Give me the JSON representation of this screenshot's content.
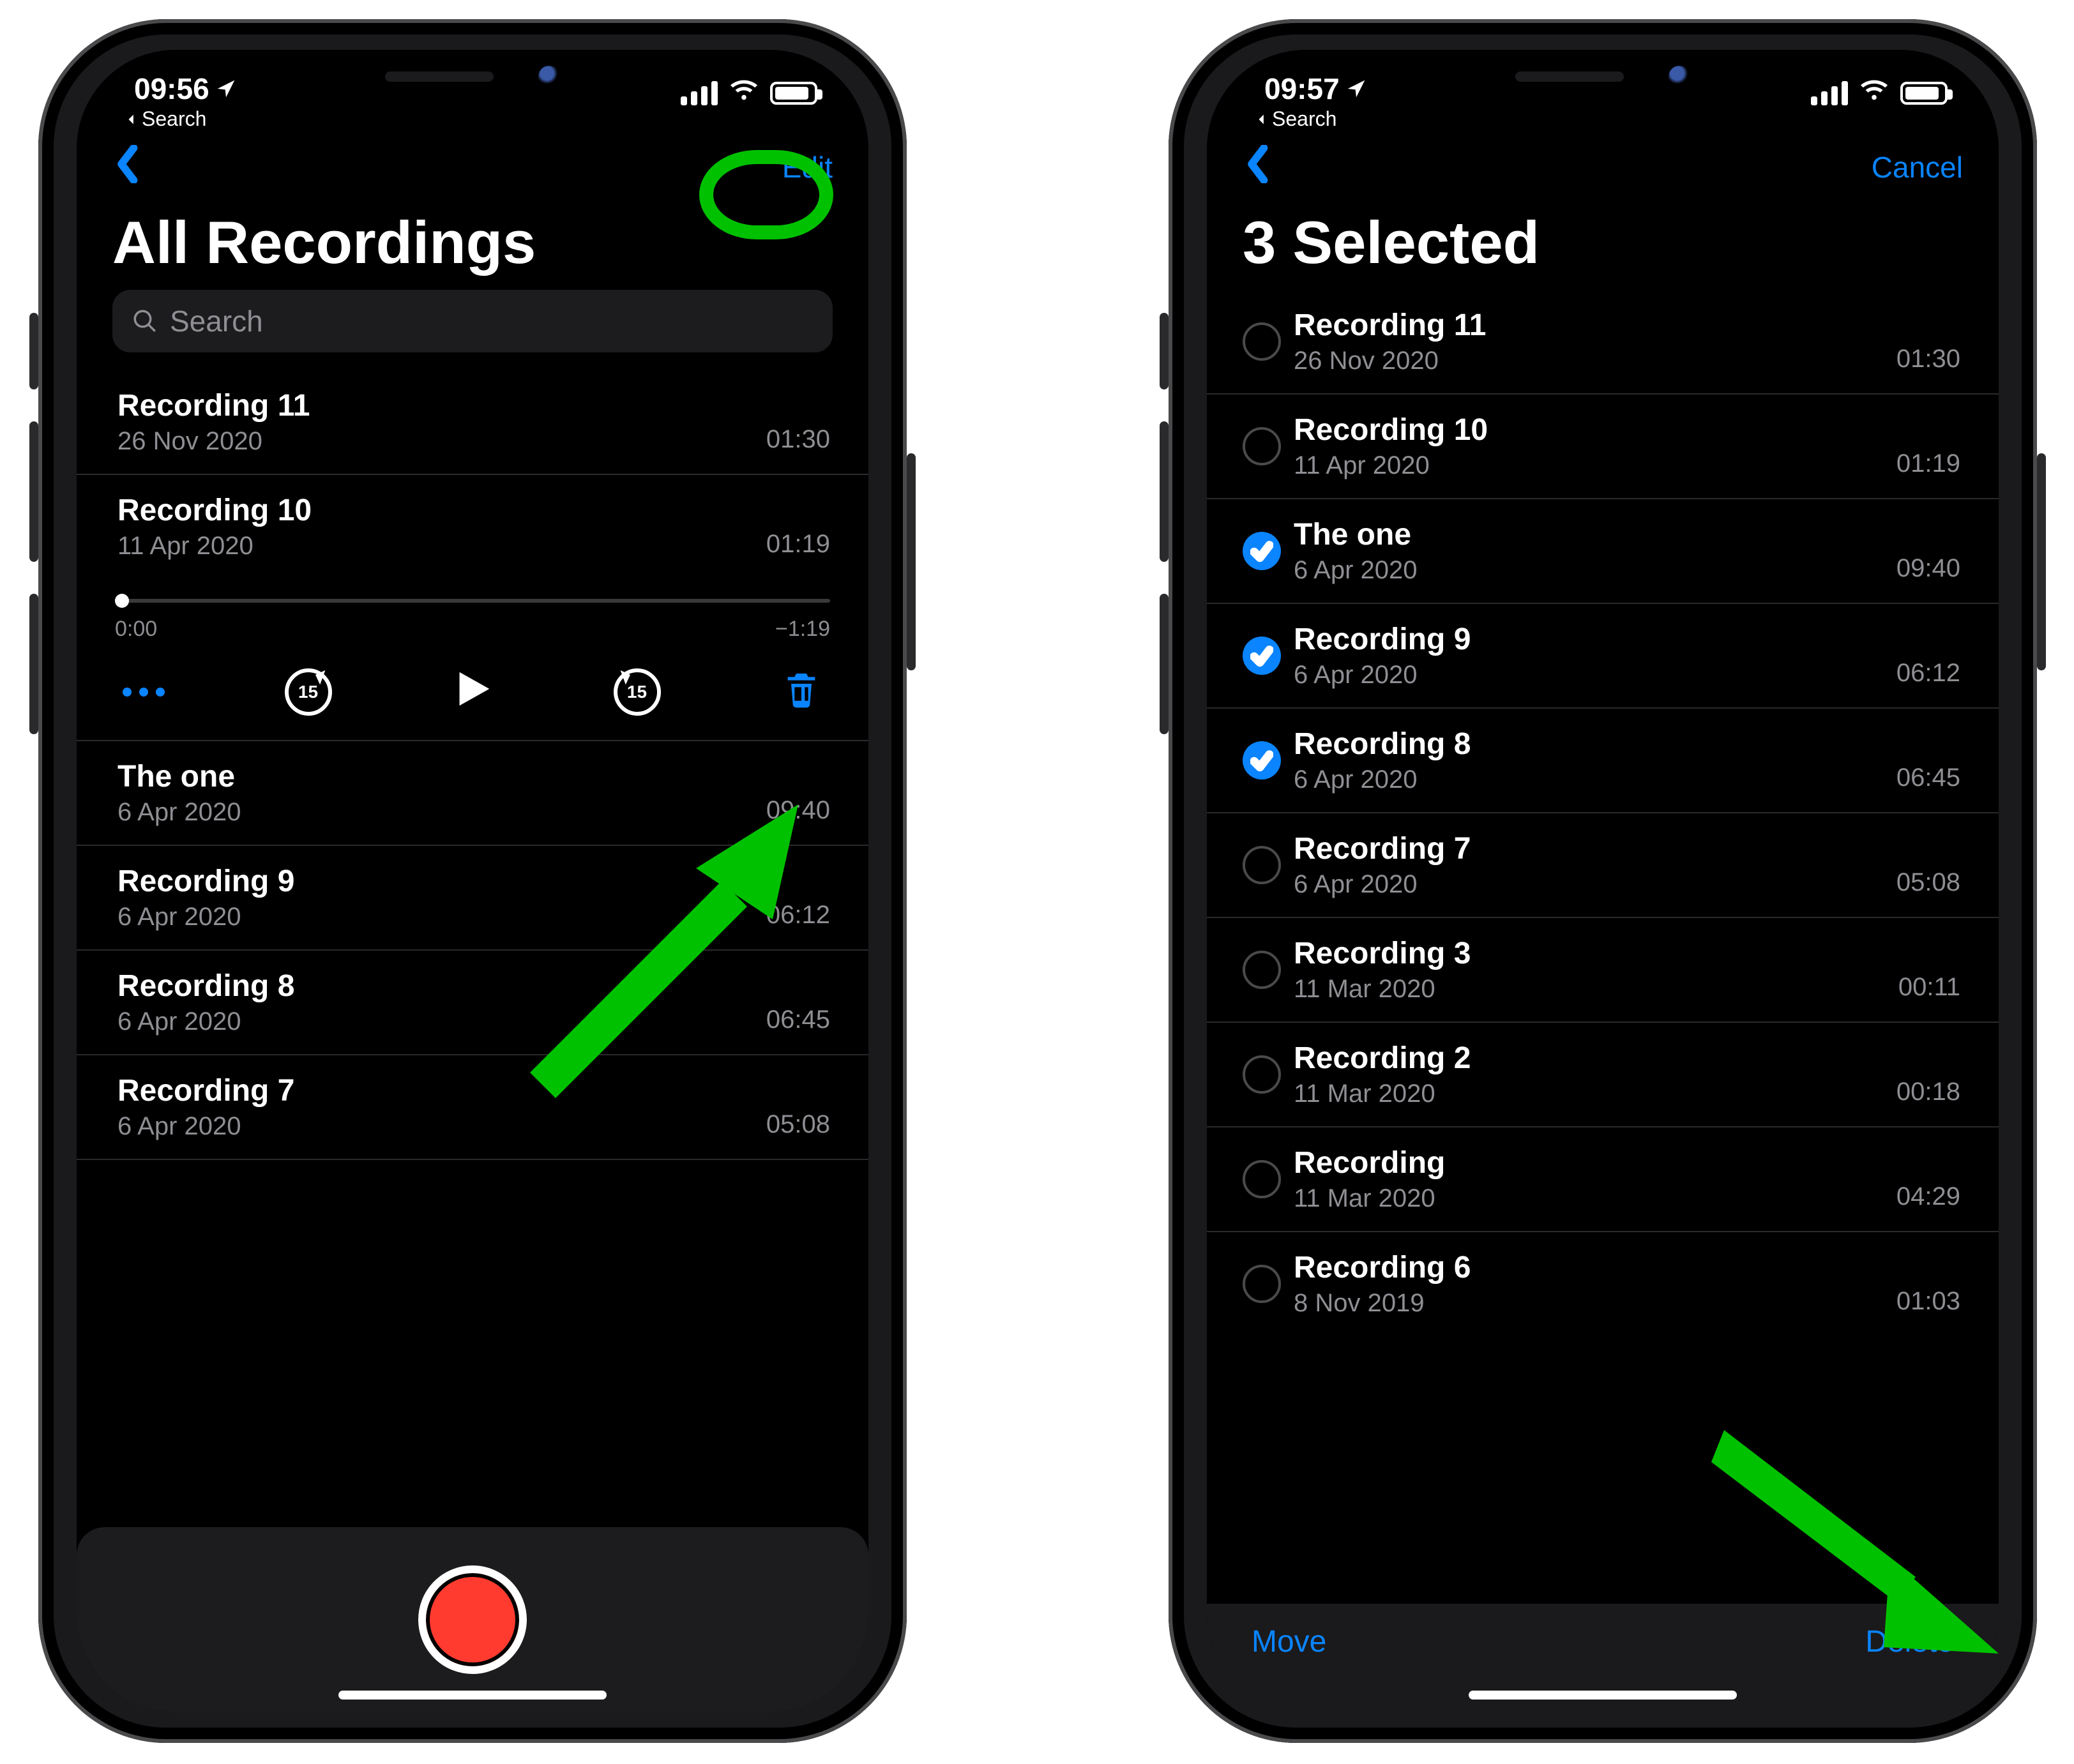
{
  "status": {
    "back_label": "Search"
  },
  "left": {
    "time": "09:56",
    "nav_edit": "Edit",
    "title": "All Recordings",
    "search_placeholder": "Search",
    "items": [
      {
        "name": "Recording 11",
        "date": "26 Nov 2020",
        "dur": "01:30"
      },
      {
        "name": "Recording 10",
        "date": "11 Apr 2020",
        "dur": "01:19"
      },
      {
        "name": "The one",
        "date": "6 Apr 2020",
        "dur": "09:40"
      },
      {
        "name": "Recording 9",
        "date": "6 Apr 2020",
        "dur": "06:12"
      },
      {
        "name": "Recording 8",
        "date": "6 Apr 2020",
        "dur": "06:45"
      },
      {
        "name": "Recording 7",
        "date": "6 Apr 2020",
        "dur": "05:08"
      }
    ],
    "player": {
      "pos": "0:00",
      "remaining": "−1:19",
      "skip_amount": "15"
    }
  },
  "right": {
    "time": "09:57",
    "nav_cancel": "Cancel",
    "title": "3 Selected",
    "footer_move": "Move",
    "footer_delete": "Delete",
    "items": [
      {
        "name": "Recording 11",
        "date": "26 Nov 2020",
        "dur": "01:30",
        "checked": false
      },
      {
        "name": "Recording 10",
        "date": "11 Apr 2020",
        "dur": "01:19",
        "checked": false
      },
      {
        "name": "The one",
        "date": "6 Apr 2020",
        "dur": "09:40",
        "checked": true
      },
      {
        "name": "Recording 9",
        "date": "6 Apr 2020",
        "dur": "06:12",
        "checked": true
      },
      {
        "name": "Recording 8",
        "date": "6 Apr 2020",
        "dur": "06:45",
        "checked": true
      },
      {
        "name": "Recording 7",
        "date": "6 Apr 2020",
        "dur": "05:08",
        "checked": false
      },
      {
        "name": "Recording 3",
        "date": "11 Mar 2020",
        "dur": "00:11",
        "checked": false
      },
      {
        "name": "Recording 2",
        "date": "11 Mar 2020",
        "dur": "00:18",
        "checked": false
      },
      {
        "name": "Recording",
        "date": "11 Mar 2020",
        "dur": "04:29",
        "checked": false
      },
      {
        "name": "Recording 6",
        "date": "8 Nov 2019",
        "dur": "01:03",
        "checked": false
      }
    ]
  }
}
